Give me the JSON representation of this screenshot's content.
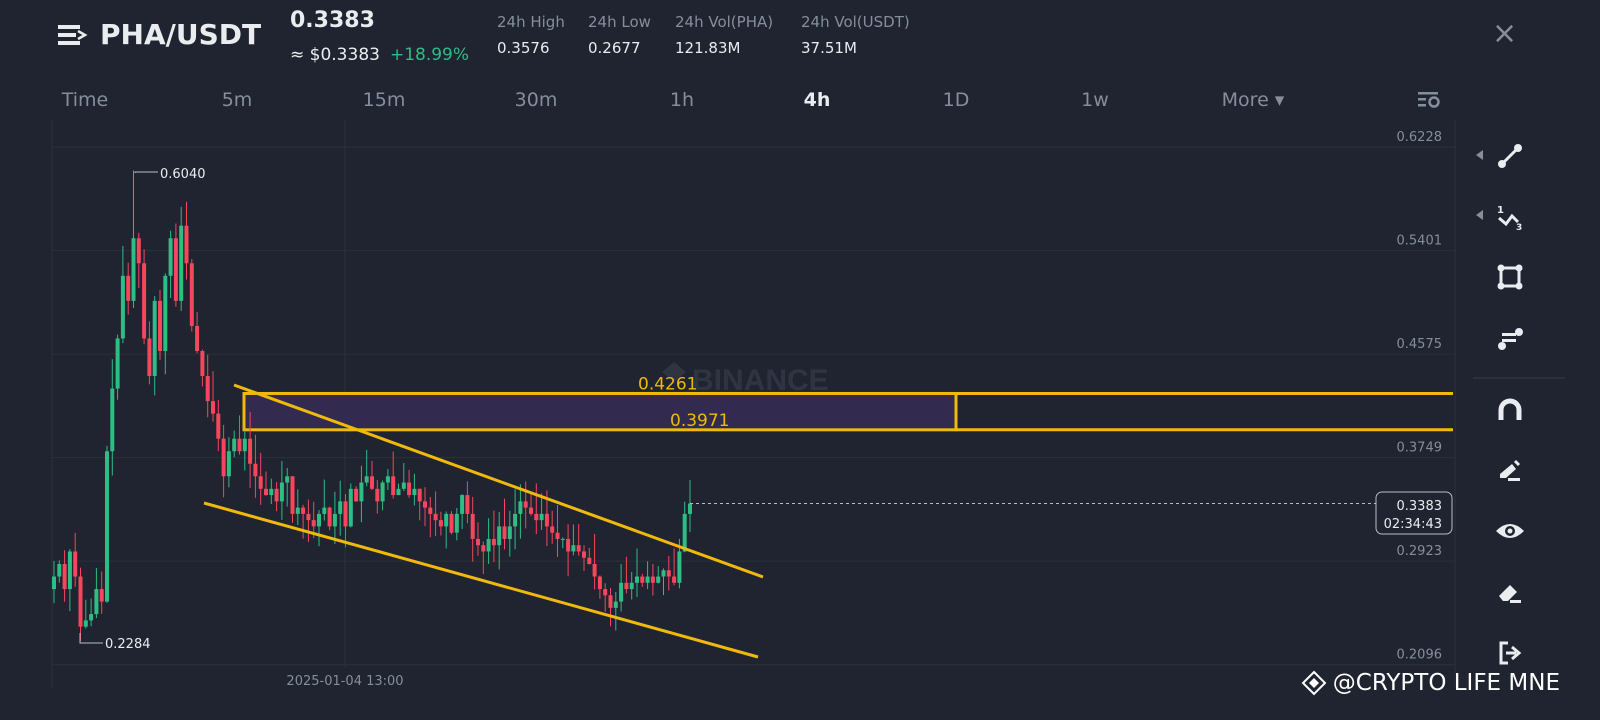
{
  "header": {
    "symbol": "PHA/USDT",
    "last_price": "0.3383",
    "usd_price": "≈ $0.3383",
    "change": "+18.99%",
    "stats": [
      {
        "label": "24h High",
        "value": "0.3576"
      },
      {
        "label": "24h Low",
        "value": "0.2677"
      },
      {
        "label": "24h Vol(PHA)",
        "value": "121.83M"
      },
      {
        "label": "24h Vol(USDT)",
        "value": "37.51M"
      }
    ],
    "close_icon": "×"
  },
  "intervals": [
    {
      "label": "Time"
    },
    {
      "label": "5m"
    },
    {
      "label": "15m"
    },
    {
      "label": "30m"
    },
    {
      "label": "1h"
    },
    {
      "label": "4h",
      "active": true
    },
    {
      "label": "1D"
    },
    {
      "label": "1w"
    },
    {
      "label": "More ▾"
    }
  ],
  "toolbar": [
    "trendline-icon",
    "fibonacci-icon",
    "rectangle-icon",
    "annotation-icon",
    "magnet-icon",
    "pen-icon",
    "eye-icon",
    "eraser-icon",
    "exit-icon"
  ],
  "colors": {
    "up": "#2ebd85",
    "down": "#f6465d",
    "drawing": "#f0b90b",
    "zone": "#322b4f"
  },
  "chart_data": {
    "type": "candlestick",
    "y_ticks": [
      "0.6228",
      "0.5401",
      "0.4575",
      "0.3749",
      "0.2923",
      "0.2096"
    ],
    "ylim": [
      0.2096,
      0.6228
    ],
    "x_label": "2025-01-04 13:00",
    "high_marker": "0.6040",
    "low_marker": "0.2284",
    "current_price": "0.3383",
    "countdown": "02:34:43",
    "zone": {
      "top": 0.4261,
      "bottom": 0.3971,
      "top_label": "0.4261",
      "bottom_label": "0.3971"
    },
    "closes": [
      0.28,
      0.29,
      0.27,
      0.3,
      0.28,
      0.24,
      0.245,
      0.25,
      0.27,
      0.26,
      0.38,
      0.43,
      0.47,
      0.52,
      0.5,
      0.55,
      0.53,
      0.47,
      0.44,
      0.5,
      0.46,
      0.52,
      0.55,
      0.5,
      0.56,
      0.53,
      0.48,
      0.46,
      0.44,
      0.42,
      0.41,
      0.39,
      0.36,
      0.38,
      0.39,
      0.38,
      0.39,
      0.37,
      0.36,
      0.35,
      0.345,
      0.35,
      0.34,
      0.355,
      0.36,
      0.33,
      0.335,
      0.33,
      0.325,
      0.32,
      0.33,
      0.335,
      0.32,
      0.33,
      0.34,
      0.32,
      0.35,
      0.34,
      0.355,
      0.36,
      0.35,
      0.34,
      0.355,
      0.36,
      0.345,
      0.35,
      0.355,
      0.345,
      0.35,
      0.34,
      0.335,
      0.33,
      0.325,
      0.32,
      0.33,
      0.315,
      0.33,
      0.345,
      0.33,
      0.31,
      0.305,
      0.3,
      0.31,
      0.305,
      0.32,
      0.31,
      0.32,
      0.33,
      0.34,
      0.335,
      0.33,
      0.325,
      0.33,
      0.32,
      0.315,
      0.31,
      0.31,
      0.3,
      0.305,
      0.3,
      0.295,
      0.29,
      0.28,
      0.27,
      0.265,
      0.255,
      0.26,
      0.275,
      0.27,
      0.275,
      0.28,
      0.275,
      0.28,
      0.275,
      0.28,
      0.285,
      0.28,
      0.275,
      0.3,
      0.33,
      0.3383
    ]
  },
  "watermark": {
    "center": "BINANCE",
    "credit": "@CRYPTO LIFE MNE"
  }
}
